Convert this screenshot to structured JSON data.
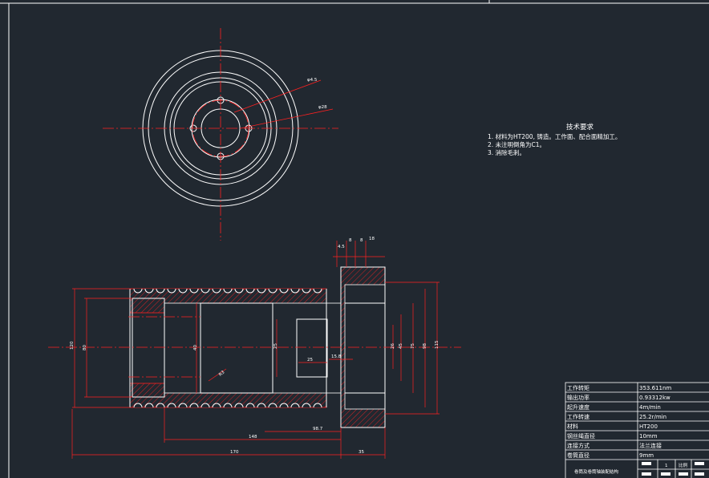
{
  "notes": {
    "title": "技术要求",
    "items": [
      "1. 材料为HT200, 铸造。工作面、配合面精加工。",
      "2. 未注明倒角为C1。",
      "3. 消除毛刺。"
    ]
  },
  "dims": {
    "circle_outer": "φ4.5",
    "circle_inner": "φ28",
    "top1": "4.5",
    "top2": "8",
    "top3": "8",
    "top4": "18",
    "left1": "120",
    "left2": "80",
    "mid1": "40",
    "mid2": "25",
    "mid3": "15.8",
    "right1": "26",
    "right2": "45",
    "right3": "75",
    "right4": "98",
    "right5": "115",
    "bottom1": "98.7",
    "bottom2": "148",
    "bottom3": "170",
    "bottom4": "35",
    "angle": "R3"
  },
  "title_block": {
    "rows": [
      {
        "label": "工作转矩",
        "value": "353.611nm"
      },
      {
        "label": "输出功率",
        "value": "0.93312kw"
      },
      {
        "label": "起升速度",
        "value": "4m/min"
      },
      {
        "label": "工作转速",
        "value": "25.2r/min"
      },
      {
        "label": "材料",
        "value": "HT200"
      },
      {
        "label": "钢丝绳直径",
        "value": "10mm"
      },
      {
        "label": "连接方式",
        "value": "法兰连接"
      },
      {
        "label": "卷筒直径",
        "value": "9mm"
      }
    ],
    "footer_left": "卷筒及卷筒轴装配结构",
    "footer_mid": "1",
    "footer_right": "比例"
  },
  "colors": {
    "background": "#212830",
    "line": "#ff2020",
    "text": "#ffffff"
  }
}
